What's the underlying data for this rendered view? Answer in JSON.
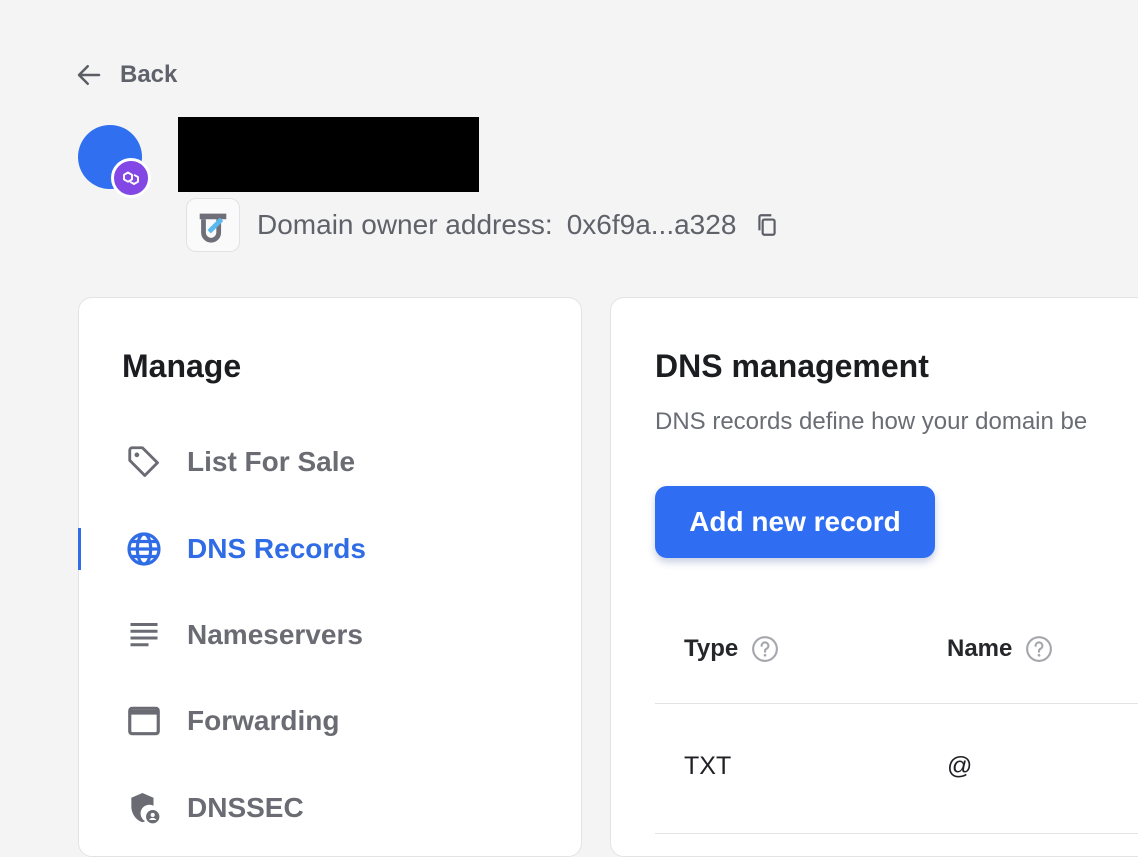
{
  "nav": {
    "back_label": "Back"
  },
  "domain": {
    "owner_label": "Domain owner address:",
    "owner_address": "0x6f9a...a328"
  },
  "manage": {
    "title": "Manage",
    "items": [
      {
        "label": "List For Sale",
        "icon": "tag-icon",
        "active": false
      },
      {
        "label": "DNS Records",
        "icon": "globe-icon",
        "active": true
      },
      {
        "label": "Nameservers",
        "icon": "lines-icon",
        "active": false
      },
      {
        "label": "Forwarding",
        "icon": "browser-window-icon",
        "active": false
      },
      {
        "label": "DNSSEC",
        "icon": "shield-user-icon",
        "active": false
      }
    ]
  },
  "dns": {
    "title": "DNS management",
    "description": "DNS records define how your domain be",
    "add_button_label": "Add new record",
    "columns": [
      "Type",
      "Name"
    ],
    "rows": [
      {
        "type": "TXT",
        "name": "@"
      }
    ]
  },
  "colors": {
    "accent": "#2f6ce5",
    "avatar": "#2f6ff0",
    "chain_badge": "#8247e5",
    "background": "#f4f4f5"
  }
}
